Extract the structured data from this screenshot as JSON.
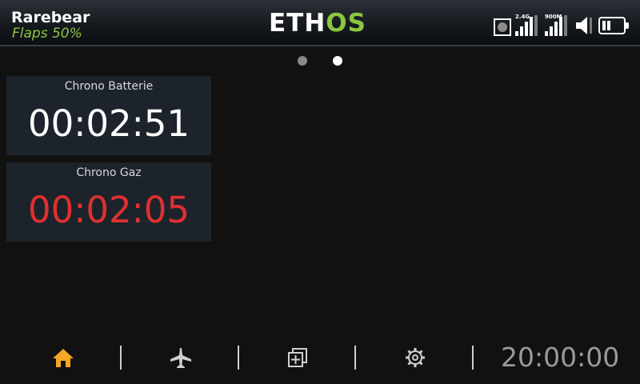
{
  "topbar": {
    "model_name": "Rarebear",
    "flight_mode": "Flaps 50%",
    "logo": {
      "part1": "ETH",
      "part2": "OS"
    },
    "rx_24_label": "2.4G",
    "rx_900_label": "900M"
  },
  "pages": {
    "count": 2,
    "active_index": 1
  },
  "widgets": [
    {
      "title": "Chrono Batterie",
      "value": "00:02:51",
      "color": "#ffffff"
    },
    {
      "title": "Chrono Gaz",
      "value": "00:02:05",
      "color": "#e03030"
    }
  ],
  "bottombar": {
    "home_icon": "home-icon",
    "model_icon": "airplane-icon",
    "displays_icon": "widgets-icon",
    "system_icon": "gear-icon",
    "clock": "20:00:00",
    "active_color": "#f5a623"
  }
}
